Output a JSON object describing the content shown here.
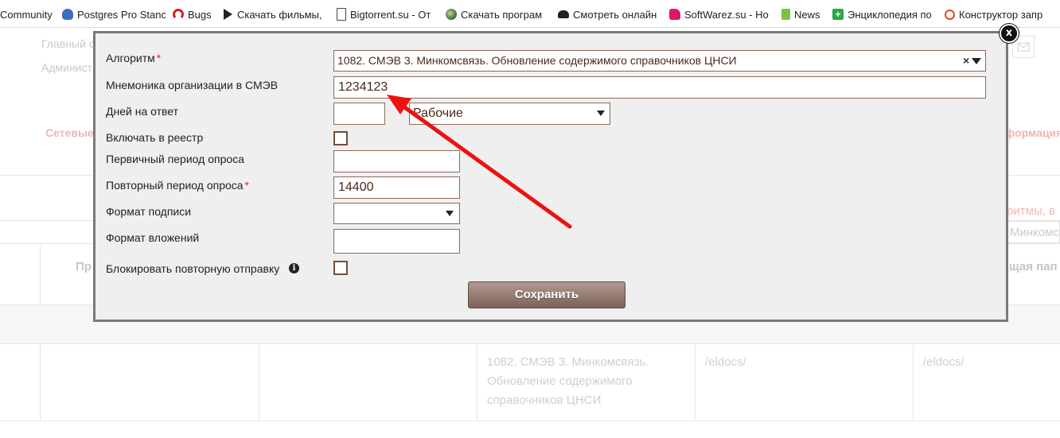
{
  "bookmarks": [
    {
      "label": "Community",
      "icon": "none"
    },
    {
      "label": "Postgres Pro Stanc",
      "icon": "elephant-icon",
      "color": "#3a6fbf"
    },
    {
      "label": "Bugs",
      "icon": "bug-gauge-icon",
      "color": "#d62020"
    },
    {
      "label": "Скачать фильмы,",
      "icon": "play-icon",
      "color": "#222222"
    },
    {
      "label": "Bigtorrent.su - От",
      "icon": "page-icon",
      "color": "#444444"
    },
    {
      "label": "Скачать програм",
      "icon": "globe-icon",
      "color": "#4a7a3a"
    },
    {
      "label": "Смотреть онлайн",
      "icon": "spy-icon",
      "color": "#222222"
    },
    {
      "label": "SoftWarez.su - Но",
      "icon": "pink-tag-icon",
      "color": "#e0166b"
    },
    {
      "label": "News",
      "icon": "news-icon",
      "color": "#7cc242"
    },
    {
      "label": "Энциклопедия по",
      "icon": "plus-book-icon",
      "color": "#2aa847"
    },
    {
      "label": "Конструктор запр",
      "icon": "constructor-icon",
      "color": "#e24a2a"
    }
  ],
  "background": {
    "nav_main": "Главный с",
    "nav_admin": "Админист",
    "tab_left": "Сетевые м",
    "tab_right": "формация",
    "header_right": "ритмы, в",
    "filter_right": "Минкомс",
    "col_left": "Пр",
    "col_right": "щая пап",
    "row_algorithm": "1082. СМЭВ 3. Минкомсвязь. Обновление содержимого справочников ЦНСИ",
    "row_path1": "/eldocs/",
    "row_path2": "/eldocs/"
  },
  "modal": {
    "fields": {
      "algorithm_label": "Алгоритм",
      "algorithm_value": "1082. СМЭВ 3. Минкомсвязь. Обновление содержимого справочников ЦНСИ",
      "clear_symbol": "×",
      "mnemonic_label": "Мнемоника организации в СМЭВ",
      "mnemonic_value": "1234123",
      "days_label": "Дней на ответ",
      "days_value": "",
      "days_type_value": "Рабочие",
      "registry_label": "Включать в реестр",
      "registry_checked": false,
      "primary_period_label": "Первичный период опроса",
      "primary_period_value": "",
      "repeat_period_label": "Повторный период опроса",
      "repeat_period_value": "14400",
      "signature_format_label": "Формат подписи",
      "signature_format_value": "",
      "attachments_format_label": "Формат вложений",
      "attachments_format_value": "",
      "block_resend_label": "Блокировать повторную отправку",
      "block_resend_checked": false
    },
    "required_mark": "*",
    "save_label": "Сохранить",
    "close_symbol": "x",
    "info_symbol": "i"
  },
  "colors": {
    "accent_brown": "#7d6157",
    "input_border": "#8b6b5a",
    "annotation_arrow": "#ee1111",
    "required": "#c0392b"
  }
}
